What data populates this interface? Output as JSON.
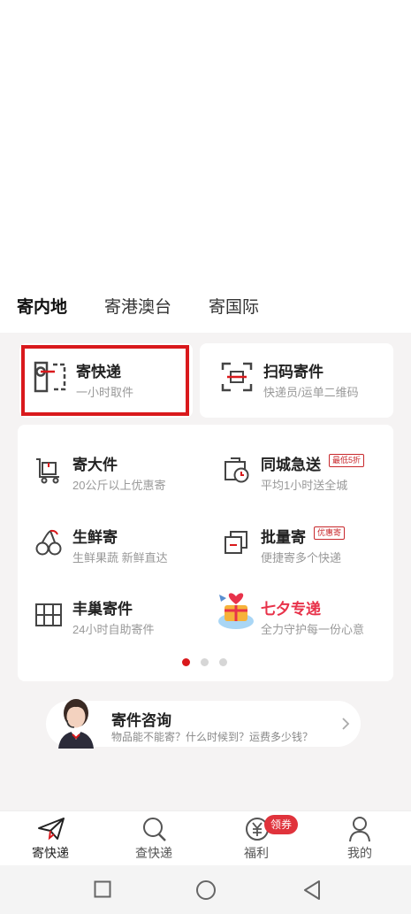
{
  "tabs": [
    {
      "label": "寄内地",
      "active": true
    },
    {
      "label": "寄港澳台",
      "active": false
    },
    {
      "label": "寄国际",
      "active": false
    }
  ],
  "top_services": [
    {
      "title": "寄快递",
      "subtitle": "一小时取件",
      "icon": "send-package-icon",
      "highlighted": true
    },
    {
      "title": "扫码寄件",
      "subtitle": "快递员/运单二维码",
      "icon": "scan-qr-icon"
    }
  ],
  "grid_services": [
    {
      "title": "寄大件",
      "subtitle": "20公斤以上优惠寄",
      "icon": "large-cart-icon"
    },
    {
      "title": "同城急送",
      "subtitle": "平均1小时送全城",
      "icon": "clock-box-icon",
      "badge": "最低5折"
    },
    {
      "title": "生鲜寄",
      "subtitle": "生鲜果蔬 新鲜直达",
      "icon": "cherry-icon"
    },
    {
      "title": "批量寄",
      "subtitle": "便捷寄多个快递",
      "icon": "stacked-boxes-icon",
      "badge": "优惠寄"
    },
    {
      "title": "丰巢寄件",
      "subtitle": "24小时自助寄件",
      "icon": "locker-grid-icon"
    },
    {
      "title": "七夕专递",
      "subtitle": "全力守护每一份心意",
      "icon": "qixi-promo-icon"
    }
  ],
  "pagination": {
    "count": 3,
    "active": 0
  },
  "consult": {
    "title": "寄件咨询",
    "subtitle": "物品能不能寄？什么时候到？运费多少钱？"
  },
  "bottom_nav": [
    {
      "label": "寄快递",
      "icon": "paper-plane-icon",
      "active": true
    },
    {
      "label": "查快递",
      "icon": "search-icon",
      "active": false
    },
    {
      "label": "福利",
      "icon": "yen-coin-icon",
      "active": false,
      "badge": "领券"
    },
    {
      "label": "我的",
      "icon": "user-icon",
      "active": false
    }
  ],
  "colors": {
    "accent": "#d9191c",
    "background": "#f5f3f3",
    "promo": "#e8324a"
  }
}
